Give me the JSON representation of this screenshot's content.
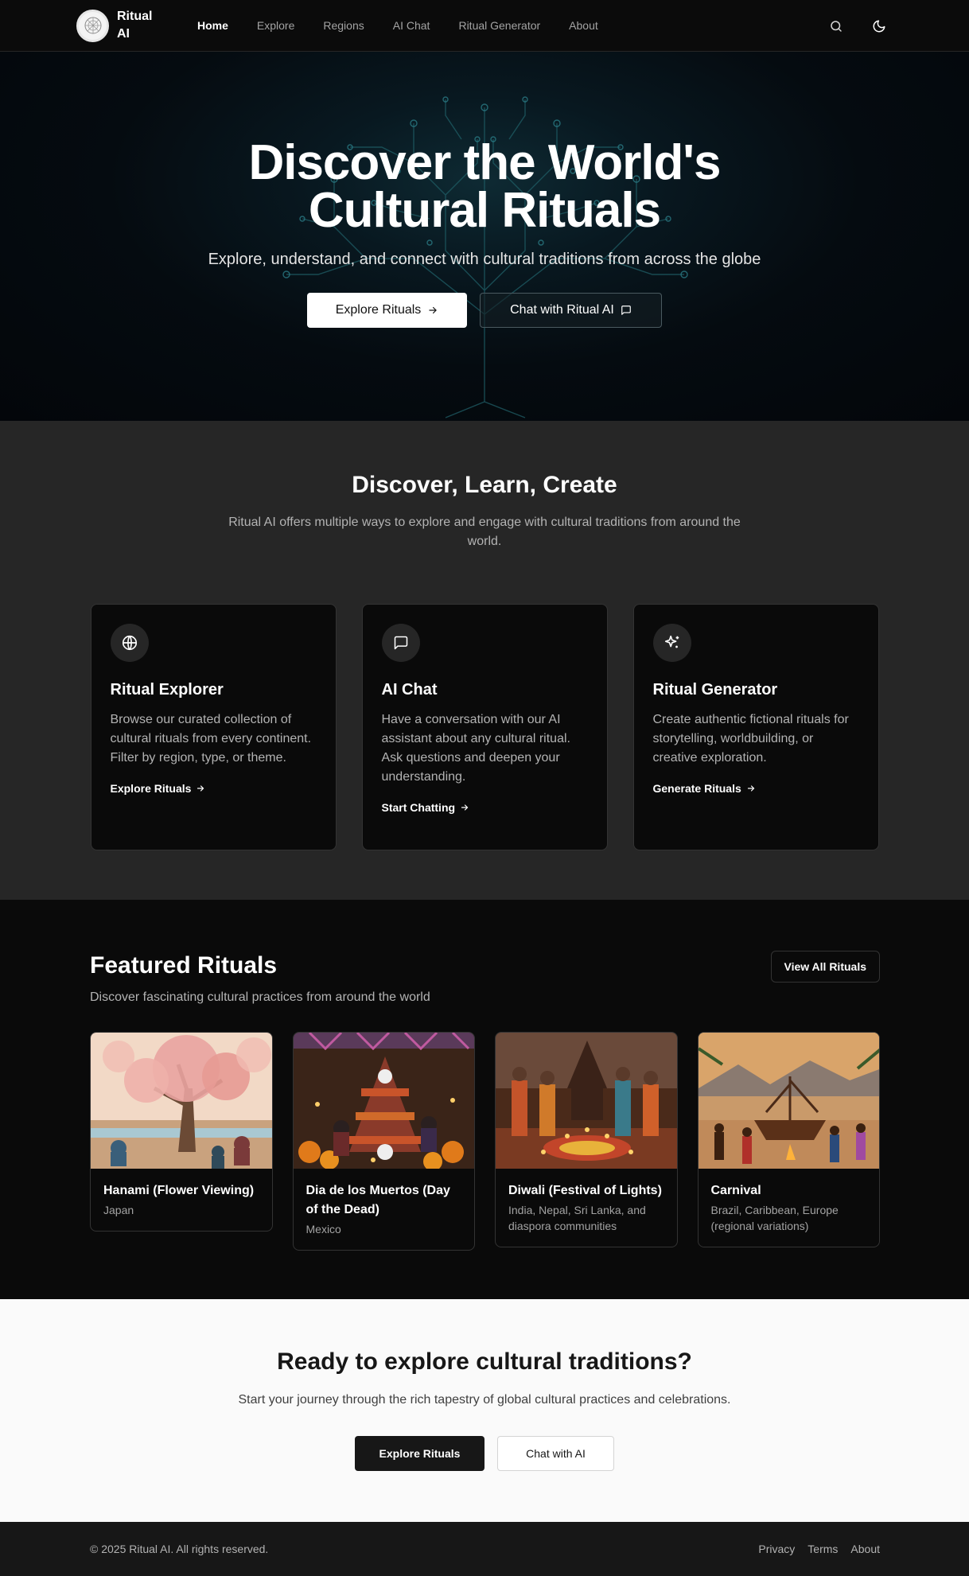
{
  "nav": {
    "logo_text": "Ritual AI",
    "links": [
      "Home",
      "Explore",
      "Regions",
      "AI Chat",
      "Ritual Generator",
      "About"
    ],
    "active_link": "Home",
    "icons": [
      "search-icon",
      "moon-icon"
    ]
  },
  "hero": {
    "title": "Discover the World's Cultural Rituals",
    "subtitle": "Explore, understand, and connect with cultural traditions from across the globe",
    "primary_button": "Explore Rituals",
    "secondary_button": "Chat with Ritual AI"
  },
  "features": {
    "title": "Discover, Learn, Create",
    "subtitle": "Ritual AI offers multiple ways to explore and engage with cultural traditions from around the world.",
    "cards": [
      {
        "icon": "globe-icon",
        "title": "Ritual Explorer",
        "text": "Browse our curated collection of cultural rituals from every continent. Filter by region, type, or theme.",
        "link": "Explore Rituals"
      },
      {
        "icon": "message-square-icon",
        "title": "AI Chat",
        "text": "Have a conversation with our AI assistant about any cultural ritual. Ask questions and deepen your understanding.",
        "link": "Start Chatting"
      },
      {
        "icon": "sparkles-icon",
        "title": "Ritual Generator",
        "text": "Create authentic fictional rituals for storytelling, worldbuilding, or creative exploration.",
        "link": "Generate Rituals"
      }
    ]
  },
  "featured": {
    "title": "Featured Rituals",
    "subtitle": "Discover fascinating cultural practices from around the world",
    "view_all": "View All Rituals",
    "rituals": [
      {
        "title": "Hanami (Flower Viewing)",
        "region": "Japan"
      },
      {
        "title": "Dia de los Muertos (Day of the Dead)",
        "region": "Mexico"
      },
      {
        "title": "Diwali (Festival of Lights)",
        "region": "India, Nepal, Sri Lanka, and diaspora communities"
      },
      {
        "title": "Carnival",
        "region": "Brazil, Caribbean, Europe (regional variations)"
      }
    ]
  },
  "cta": {
    "title": "Ready to explore cultural traditions?",
    "subtitle": "Start your journey through the rich tapestry of global cultural practices and celebrations.",
    "primary_button": "Explore Rituals",
    "secondary_button": "Chat with AI"
  },
  "footer": {
    "copyright": "© 2025 Ritual AI. All rights reserved.",
    "links": [
      "Privacy",
      "Terms",
      "About"
    ]
  }
}
